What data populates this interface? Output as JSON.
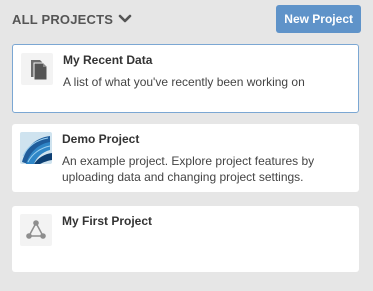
{
  "header": {
    "title": "ALL PROJECTS",
    "new_button": "New Project"
  },
  "projects": [
    {
      "title": "My Recent Data",
      "description": "A list of what you've recently been working on",
      "icon": "documents-icon",
      "selected": true
    },
    {
      "title": "Demo Project",
      "description": "An example project. Explore project features by uploading data and changing project settings.",
      "icon": "demo-project-thumbnail"
    },
    {
      "title": "My First Project",
      "description": "",
      "icon": "network-triangle-icon"
    }
  ],
  "colors": {
    "background": "#e6e6e6",
    "button": "#5f93c9",
    "selected_border": "#7ba7d3"
  }
}
